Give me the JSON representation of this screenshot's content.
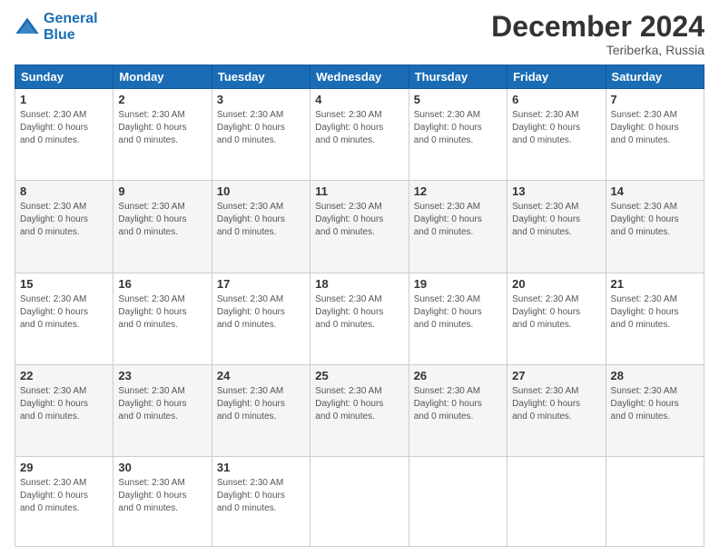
{
  "logo": {
    "line1": "General",
    "line2": "Blue"
  },
  "header": {
    "month_year": "December 2024",
    "location": "Teriberka, Russia"
  },
  "days_of_week": [
    "Sunday",
    "Monday",
    "Tuesday",
    "Wednesday",
    "Thursday",
    "Friday",
    "Saturday"
  ],
  "cell_info": "Sunset: 2:30 AM\nDaylight: 0 hours and 0 minutes.",
  "weeks": [
    [
      {
        "day": "1",
        "empty": false
      },
      {
        "day": "2",
        "empty": false
      },
      {
        "day": "3",
        "empty": false
      },
      {
        "day": "4",
        "empty": false
      },
      {
        "day": "5",
        "empty": false
      },
      {
        "day": "6",
        "empty": false
      },
      {
        "day": "7",
        "empty": false
      }
    ],
    [
      {
        "day": "8",
        "empty": false
      },
      {
        "day": "9",
        "empty": false
      },
      {
        "day": "10",
        "empty": false
      },
      {
        "day": "11",
        "empty": false
      },
      {
        "day": "12",
        "empty": false
      },
      {
        "day": "13",
        "empty": false
      },
      {
        "day": "14",
        "empty": false
      }
    ],
    [
      {
        "day": "15",
        "empty": false
      },
      {
        "day": "16",
        "empty": false
      },
      {
        "day": "17",
        "empty": false
      },
      {
        "day": "18",
        "empty": false
      },
      {
        "day": "19",
        "empty": false
      },
      {
        "day": "20",
        "empty": false
      },
      {
        "day": "21",
        "empty": false
      }
    ],
    [
      {
        "day": "22",
        "empty": false
      },
      {
        "day": "23",
        "empty": false
      },
      {
        "day": "24",
        "empty": false
      },
      {
        "day": "25",
        "empty": false
      },
      {
        "day": "26",
        "empty": false
      },
      {
        "day": "27",
        "empty": false
      },
      {
        "day": "28",
        "empty": false
      }
    ],
    [
      {
        "day": "29",
        "empty": false
      },
      {
        "day": "30",
        "empty": false
      },
      {
        "day": "31",
        "empty": false
      },
      {
        "day": "",
        "empty": true
      },
      {
        "day": "",
        "empty": true
      },
      {
        "day": "",
        "empty": true
      },
      {
        "day": "",
        "empty": true
      }
    ]
  ]
}
